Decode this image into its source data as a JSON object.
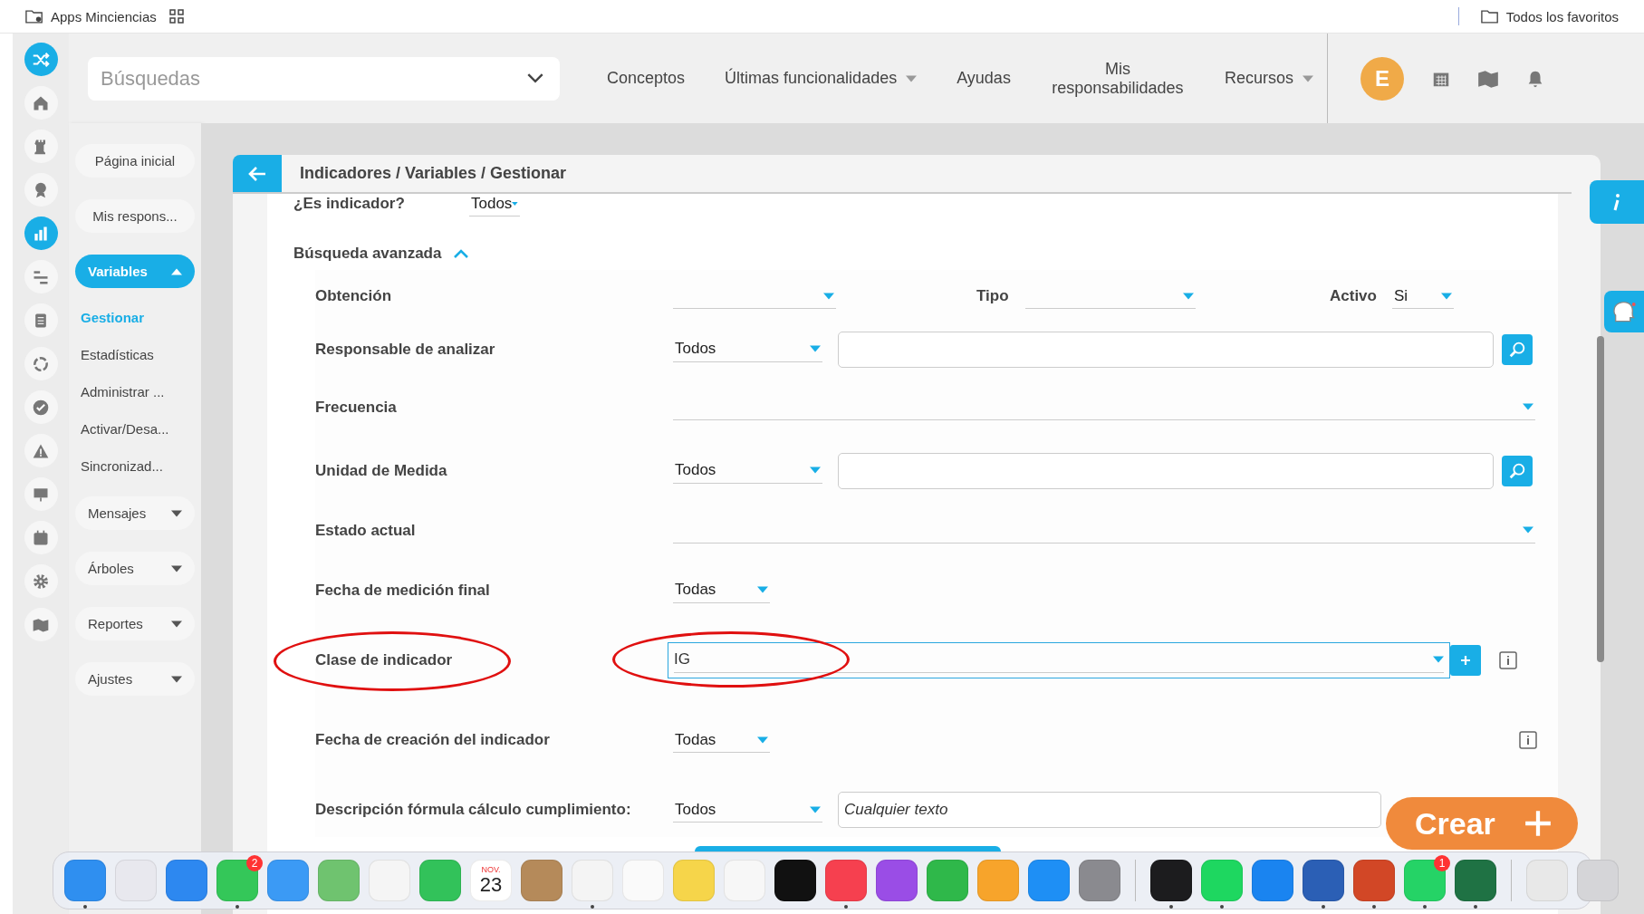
{
  "browser_bar": {
    "bookmark": "Apps Minciencias",
    "favorites": "Todos los favoritos"
  },
  "rail": [
    {
      "kind": "home",
      "selected": false
    },
    {
      "kind": "rook",
      "selected": false
    },
    {
      "kind": "award",
      "selected": false
    },
    {
      "kind": "chart",
      "selected": true
    },
    {
      "kind": "lines",
      "selected": false
    },
    {
      "kind": "doc",
      "selected": false
    },
    {
      "kind": "cycle",
      "selected": false
    },
    {
      "kind": "check",
      "selected": false
    },
    {
      "kind": "warning",
      "selected": false
    },
    {
      "kind": "screen",
      "selected": false
    },
    {
      "kind": "calendar",
      "selected": false
    },
    {
      "kind": "gear",
      "selected": false
    },
    {
      "kind": "map",
      "selected": false
    }
  ],
  "header": {
    "search": {
      "placeholder": "Búsquedas"
    },
    "nav": [
      {
        "label": "Conceptos",
        "dropdown": false
      },
      {
        "label": "Últimas funcionalidades",
        "dropdown": true
      },
      {
        "label": "Ayudas",
        "dropdown": false
      },
      {
        "label": "Mis responsabilidades",
        "dropdown": false
      },
      {
        "label": "Recursos",
        "dropdown": true
      }
    ],
    "avatar": "E"
  },
  "sidebar": [
    {
      "label": "Página inicial",
      "kind": "link"
    },
    {
      "label": "Mis respons...",
      "kind": "link"
    },
    {
      "label": "Variables",
      "kind": "group",
      "expanded": true,
      "selected": true,
      "children": [
        {
          "label": "Gestionar",
          "selected": true
        },
        {
          "label": "Estadísticas",
          "selected": false
        },
        {
          "label": "Administrar ...",
          "selected": false
        },
        {
          "label": "Activar/Desa...",
          "selected": false
        },
        {
          "label": "Sincronizad...",
          "selected": false
        }
      ]
    },
    {
      "label": "Mensajes",
      "kind": "group",
      "expanded": false,
      "selected": false
    },
    {
      "label": "Árboles",
      "kind": "group",
      "expanded": false,
      "selected": false
    },
    {
      "label": "Reportes",
      "kind": "group",
      "expanded": false,
      "selected": false
    },
    {
      "label": "Ajustes",
      "kind": "group",
      "expanded": false,
      "selected": false
    }
  ],
  "breadcrumb": "Indicadores / Variables / Gestionar",
  "es_indicador": {
    "label": "¿Es indicador?",
    "value": "Todos"
  },
  "advanced": {
    "title": "Búsqueda avanzada",
    "expanded": true,
    "rows": [
      {
        "kind": "triple",
        "label": "Obtención",
        "value": "",
        "label2": "Tipo",
        "value2": "",
        "label3": "Activo",
        "value3": "Si"
      },
      {
        "kind": "select_search",
        "label": "Responsable de analizar",
        "value": "Todos"
      },
      {
        "kind": "wide_select",
        "label": "Frecuencia"
      },
      {
        "kind": "select_search",
        "label": "Unidad de Medida",
        "value": "Todos"
      },
      {
        "kind": "wide_select",
        "label": "Estado actual"
      },
      {
        "kind": "select",
        "label": "Fecha de medición final",
        "value": "Todas",
        "info": false
      },
      {
        "kind": "combo_add",
        "label": "Clase de indicador",
        "value": "IG",
        "focused": true,
        "info": true,
        "highlighted": true
      },
      {
        "kind": "select",
        "label": "Fecha de creación del indicador",
        "value": "Todas",
        "info": true
      },
      {
        "kind": "select_text",
        "label": "Descripción fórmula cálculo cumplimiento:",
        "value": "Todos",
        "placeholder": "Cualquier texto"
      }
    ]
  },
  "create_button": "Crear",
  "dock": [
    {
      "color": "#2f8ff0",
      "running": true
    },
    {
      "color": "#e8e8ee",
      "running": false
    },
    {
      "color": "#2d88f0",
      "running": false
    },
    {
      "color": "#34c759",
      "running": true,
      "badge": "2"
    },
    {
      "color": "#3b9af5",
      "running": false
    },
    {
      "color": "#6fc36f",
      "running": false
    },
    {
      "color": "#f5f5f5",
      "running": false
    },
    {
      "color": "#32c25a",
      "running": false
    },
    {
      "color": "#ffffff",
      "running": false,
      "month": "NOV.",
      "day": "23"
    },
    {
      "color": "#b58a5a",
      "running": false
    },
    {
      "color": "#f4f4f4",
      "running": true
    },
    {
      "color": "#fafafa",
      "running": false
    },
    {
      "color": "#f6d54a",
      "running": false
    },
    {
      "color": "#f7f7f7",
      "running": false
    },
    {
      "color": "#111111",
      "running": false
    },
    {
      "color": "#f6404f",
      "running": true
    },
    {
      "color": "#9a4de6",
      "running": false
    },
    {
      "color": "#2fb84a",
      "running": false
    },
    {
      "color": "#f7a42b",
      "running": false
    },
    {
      "color": "#1e8ff5",
      "running": false
    },
    {
      "color": "#8a8a8f",
      "running": false,
      "separator_after": true
    },
    {
      "color": "#1c1c1e",
      "running": true
    },
    {
      "color": "#1ed760",
      "running": true
    },
    {
      "color": "#1a84f0",
      "running": false
    },
    {
      "color": "#2b5fb5",
      "running": true
    },
    {
      "color": "#d24726",
      "running": true
    },
    {
      "color": "#25d366",
      "running": true,
      "badge": "1"
    },
    {
      "color": "#1f7244",
      "running": true,
      "separator_after": true
    },
    {
      "color": "#e8e8e8",
      "running": false
    },
    {
      "color": "#d5d5d8",
      "running": false
    }
  ]
}
